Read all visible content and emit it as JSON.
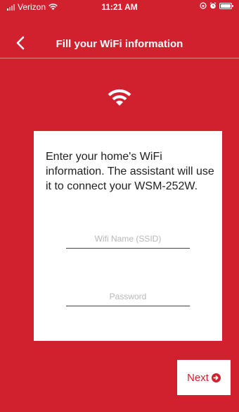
{
  "status_bar": {
    "carrier": "Verizon",
    "time": "11:21 AM"
  },
  "nav": {
    "title": "Fill your WiFi information"
  },
  "card": {
    "instructions": "Enter your home's WiFi information. The assistant will use it to connect your WSM-252W.",
    "ssid": {
      "value": "",
      "placeholder": "Wifi Name (SSID)"
    },
    "password": {
      "value": "",
      "placeholder": "Password"
    }
  },
  "next_button": {
    "label": "Next"
  },
  "colors": {
    "brand_red": "#d1202e",
    "card_bg": "#ffffff",
    "text": "#222222",
    "placeholder": "#b8b8b8"
  },
  "icons": {
    "back": "chevron-left-icon",
    "wifi": "wifi-icon",
    "next": "arrow-right-circle-icon"
  }
}
